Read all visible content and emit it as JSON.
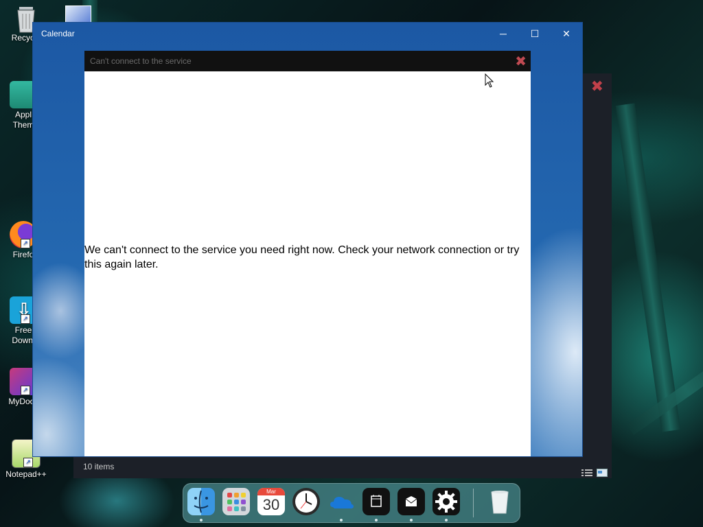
{
  "desktop": {
    "icons": [
      {
        "label": "Recycle",
        "icon": "recycle-bin-icon"
      },
      {
        "label": "Appl\nThem",
        "icon": "folder-icon"
      },
      {
        "label": "Firefo",
        "icon": "firefox-icon"
      },
      {
        "label": "Free\nDownl",
        "icon": "download-manager-icon"
      },
      {
        "label": "MyDock",
        "icon": "mydock-icon"
      },
      {
        "label": "Notepad++",
        "icon": "notepad-plus-plus-icon"
      }
    ]
  },
  "background_window": {
    "status": "10 items",
    "close_icon": "close-icon"
  },
  "calendar_window": {
    "title": "Calendar",
    "controls": {
      "minimize": "─",
      "maximize": "☐",
      "close": "✕"
    }
  },
  "dialog": {
    "title": "Can't connect to the service",
    "close_glyph": "✖",
    "message": "We can't connect to the service you need right now. Check your network connection or try this again later."
  },
  "dock": {
    "items": [
      {
        "name": "finder",
        "icon": "finder-icon",
        "running": true
      },
      {
        "name": "launchpad",
        "icon": "launchpad-icon",
        "running": false
      },
      {
        "name": "calendar",
        "icon": "calendar-icon",
        "month": "Mar",
        "day": "30",
        "running": false
      },
      {
        "name": "clock",
        "icon": "clock-icon",
        "running": false
      },
      {
        "name": "onedrive",
        "icon": "onedrive-icon",
        "running": true
      },
      {
        "name": "calendar-app",
        "icon": "calendar-app-icon",
        "running": true
      },
      {
        "name": "mail",
        "icon": "mail-icon",
        "running": true
      },
      {
        "name": "settings",
        "icon": "settings-gear-icon",
        "running": true
      },
      {
        "name": "trash",
        "icon": "trash-icon",
        "running": false
      }
    ]
  },
  "colors": {
    "calendar_titlebar": "#1c58a4",
    "dialog_header": "#111111",
    "dialog_close": "#c04a52",
    "dock_bg": "#5faaaf"
  }
}
